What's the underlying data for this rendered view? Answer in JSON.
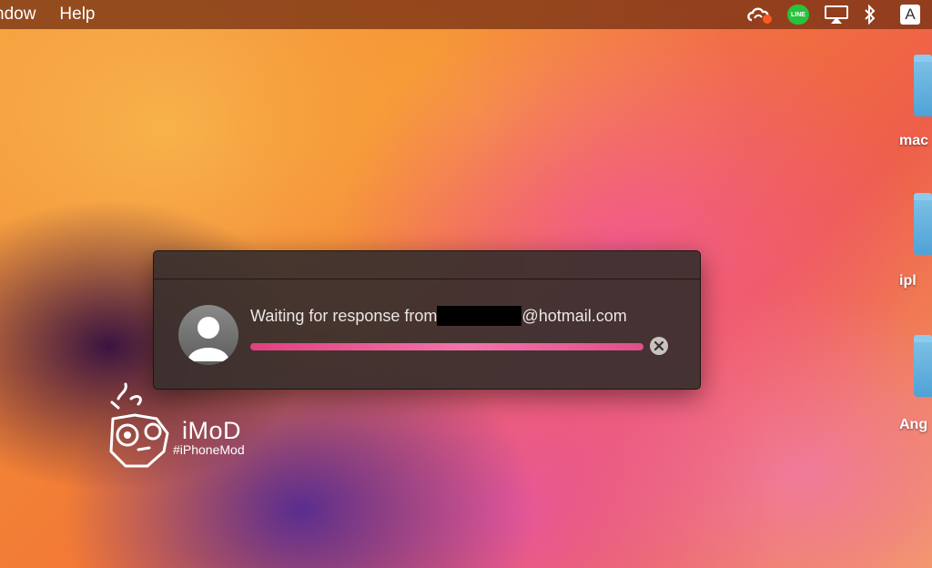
{
  "menubar": {
    "items": [
      {
        "label": "ndow"
      },
      {
        "label": "Help"
      }
    ],
    "status_icons": [
      "creative-cloud-icon",
      "line-app-icon",
      "airplay-icon",
      "bluetooth-icon",
      "input-source-icon"
    ],
    "line_icon_text": "LINE",
    "input_source_text": "A"
  },
  "desktop": {
    "items": [
      {
        "label": "mac"
      },
      {
        "label": "ipl"
      },
      {
        "label": "Ang"
      }
    ]
  },
  "dialog": {
    "message_prefix": "Waiting for response from",
    "message_suffix": "@hotmail.com",
    "progress": 1.0
  },
  "watermark": {
    "title": "iMoD",
    "subtitle": "#iPhoneMod"
  },
  "colors": {
    "progress": "#e0407e",
    "line_green": "#28c23c",
    "dialog_bg": "#3a302e"
  }
}
